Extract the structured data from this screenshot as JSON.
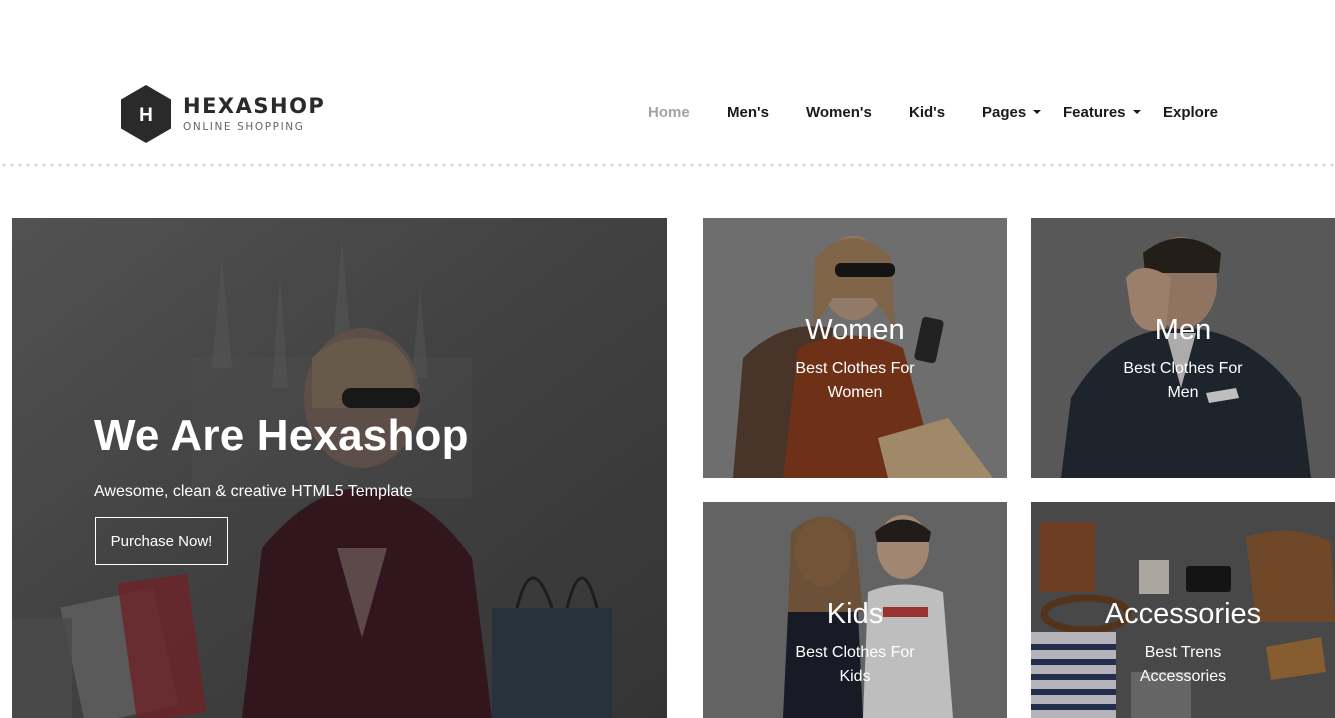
{
  "brand": {
    "logo_letter": "H",
    "name": "HEXASHOP",
    "tagline": "ONLINE SHOPPING"
  },
  "nav": {
    "items": [
      {
        "label": "Home",
        "active": true,
        "dropdown": false
      },
      {
        "label": "Men's",
        "active": false,
        "dropdown": false
      },
      {
        "label": "Women's",
        "active": false,
        "dropdown": false
      },
      {
        "label": "Kid's",
        "active": false,
        "dropdown": false
      },
      {
        "label": "Pages",
        "active": false,
        "dropdown": true
      },
      {
        "label": "Features",
        "active": false,
        "dropdown": true
      },
      {
        "label": "Explore",
        "active": false,
        "dropdown": false
      }
    ]
  },
  "hero": {
    "title": "We Are Hexashop",
    "subtitle": "Awesome, clean & creative HTML5 Template",
    "button_label": "Purchase Now!"
  },
  "categories": [
    {
      "title": "Women",
      "description": "Best Clothes For Women"
    },
    {
      "title": "Men",
      "description": "Best Clothes For Men"
    },
    {
      "title": "Kids",
      "description": "Best Clothes For Kids"
    },
    {
      "title": "Accessories",
      "description": "Best Trens Accessories"
    }
  ],
  "colors": {
    "brand_dark": "#2a2a2a",
    "nav_active": "#a3a3a3",
    "nav_text": "#1a1a1a"
  }
}
